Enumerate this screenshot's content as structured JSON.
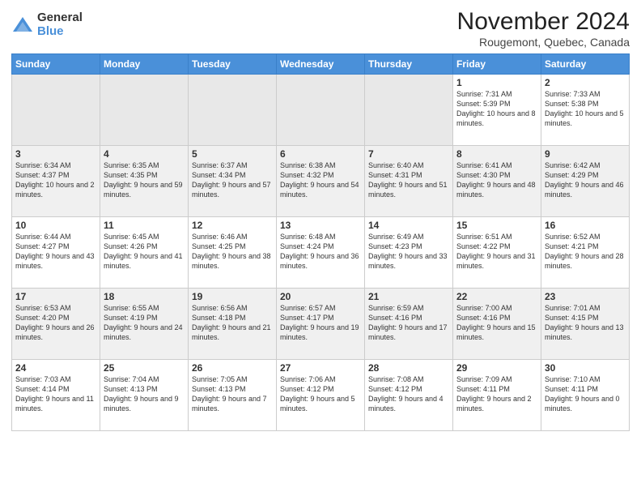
{
  "header": {
    "logo_general": "General",
    "logo_blue": "Blue",
    "month_title": "November 2024",
    "location": "Rougemont, Quebec, Canada"
  },
  "weekdays": [
    "Sunday",
    "Monday",
    "Tuesday",
    "Wednesday",
    "Thursday",
    "Friday",
    "Saturday"
  ],
  "weeks": [
    [
      {
        "day": "",
        "info": ""
      },
      {
        "day": "",
        "info": ""
      },
      {
        "day": "",
        "info": ""
      },
      {
        "day": "",
        "info": ""
      },
      {
        "day": "",
        "info": ""
      },
      {
        "day": "1",
        "info": "Sunrise: 7:31 AM\nSunset: 5:39 PM\nDaylight: 10 hours and 8 minutes."
      },
      {
        "day": "2",
        "info": "Sunrise: 7:33 AM\nSunset: 5:38 PM\nDaylight: 10 hours and 5 minutes."
      }
    ],
    [
      {
        "day": "3",
        "info": "Sunrise: 6:34 AM\nSunset: 4:37 PM\nDaylight: 10 hours and 2 minutes."
      },
      {
        "day": "4",
        "info": "Sunrise: 6:35 AM\nSunset: 4:35 PM\nDaylight: 9 hours and 59 minutes."
      },
      {
        "day": "5",
        "info": "Sunrise: 6:37 AM\nSunset: 4:34 PM\nDaylight: 9 hours and 57 minutes."
      },
      {
        "day": "6",
        "info": "Sunrise: 6:38 AM\nSunset: 4:32 PM\nDaylight: 9 hours and 54 minutes."
      },
      {
        "day": "7",
        "info": "Sunrise: 6:40 AM\nSunset: 4:31 PM\nDaylight: 9 hours and 51 minutes."
      },
      {
        "day": "8",
        "info": "Sunrise: 6:41 AM\nSunset: 4:30 PM\nDaylight: 9 hours and 48 minutes."
      },
      {
        "day": "9",
        "info": "Sunrise: 6:42 AM\nSunset: 4:29 PM\nDaylight: 9 hours and 46 minutes."
      }
    ],
    [
      {
        "day": "10",
        "info": "Sunrise: 6:44 AM\nSunset: 4:27 PM\nDaylight: 9 hours and 43 minutes."
      },
      {
        "day": "11",
        "info": "Sunrise: 6:45 AM\nSunset: 4:26 PM\nDaylight: 9 hours and 41 minutes."
      },
      {
        "day": "12",
        "info": "Sunrise: 6:46 AM\nSunset: 4:25 PM\nDaylight: 9 hours and 38 minutes."
      },
      {
        "day": "13",
        "info": "Sunrise: 6:48 AM\nSunset: 4:24 PM\nDaylight: 9 hours and 36 minutes."
      },
      {
        "day": "14",
        "info": "Sunrise: 6:49 AM\nSunset: 4:23 PM\nDaylight: 9 hours and 33 minutes."
      },
      {
        "day": "15",
        "info": "Sunrise: 6:51 AM\nSunset: 4:22 PM\nDaylight: 9 hours and 31 minutes."
      },
      {
        "day": "16",
        "info": "Sunrise: 6:52 AM\nSunset: 4:21 PM\nDaylight: 9 hours and 28 minutes."
      }
    ],
    [
      {
        "day": "17",
        "info": "Sunrise: 6:53 AM\nSunset: 4:20 PM\nDaylight: 9 hours and 26 minutes."
      },
      {
        "day": "18",
        "info": "Sunrise: 6:55 AM\nSunset: 4:19 PM\nDaylight: 9 hours and 24 minutes."
      },
      {
        "day": "19",
        "info": "Sunrise: 6:56 AM\nSunset: 4:18 PM\nDaylight: 9 hours and 21 minutes."
      },
      {
        "day": "20",
        "info": "Sunrise: 6:57 AM\nSunset: 4:17 PM\nDaylight: 9 hours and 19 minutes."
      },
      {
        "day": "21",
        "info": "Sunrise: 6:59 AM\nSunset: 4:16 PM\nDaylight: 9 hours and 17 minutes."
      },
      {
        "day": "22",
        "info": "Sunrise: 7:00 AM\nSunset: 4:16 PM\nDaylight: 9 hours and 15 minutes."
      },
      {
        "day": "23",
        "info": "Sunrise: 7:01 AM\nSunset: 4:15 PM\nDaylight: 9 hours and 13 minutes."
      }
    ],
    [
      {
        "day": "24",
        "info": "Sunrise: 7:03 AM\nSunset: 4:14 PM\nDaylight: 9 hours and 11 minutes."
      },
      {
        "day": "25",
        "info": "Sunrise: 7:04 AM\nSunset: 4:13 PM\nDaylight: 9 hours and 9 minutes."
      },
      {
        "day": "26",
        "info": "Sunrise: 7:05 AM\nSunset: 4:13 PM\nDaylight: 9 hours and 7 minutes."
      },
      {
        "day": "27",
        "info": "Sunrise: 7:06 AM\nSunset: 4:12 PM\nDaylight: 9 hours and 5 minutes."
      },
      {
        "day": "28",
        "info": "Sunrise: 7:08 AM\nSunset: 4:12 PM\nDaylight: 9 hours and 4 minutes."
      },
      {
        "day": "29",
        "info": "Sunrise: 7:09 AM\nSunset: 4:11 PM\nDaylight: 9 hours and 2 minutes."
      },
      {
        "day": "30",
        "info": "Sunrise: 7:10 AM\nSunset: 4:11 PM\nDaylight: 9 hours and 0 minutes."
      }
    ]
  ]
}
